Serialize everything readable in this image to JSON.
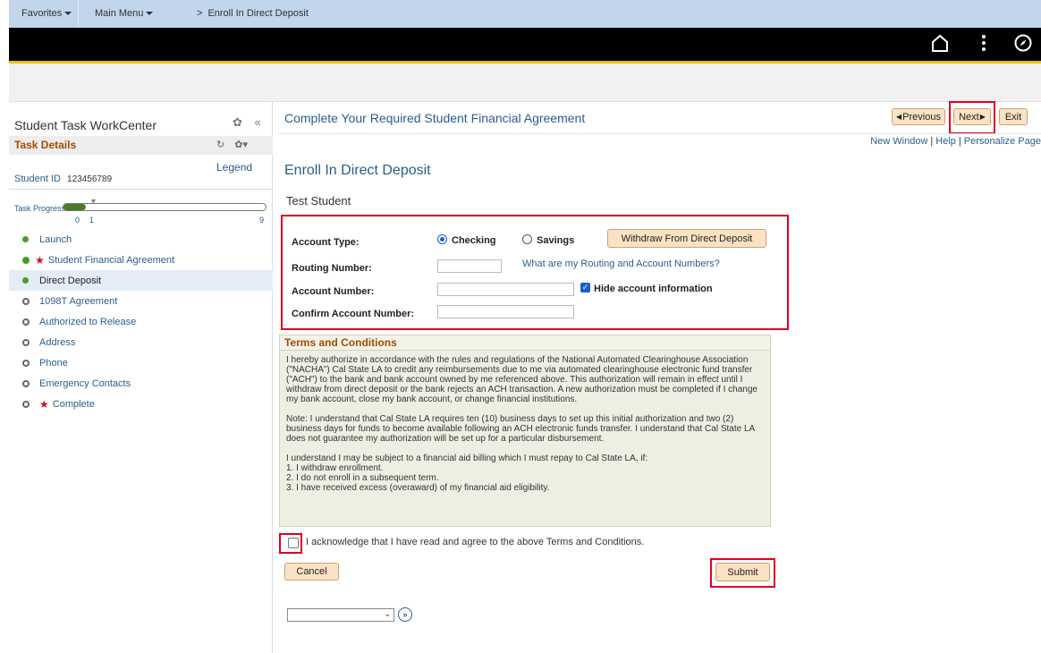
{
  "nav": {
    "favorites": "Favorites",
    "main_menu": "Main Menu",
    "breadcrumb_sep": ">",
    "breadcrumb": "Enroll In Direct Deposit"
  },
  "icons": [
    "home-icon",
    "kebab-menu-icon",
    "compass-icon",
    "settings-icon",
    "collapse-icon",
    "refresh-icon",
    "gear-dropdown-icon",
    "next-circle-icon"
  ],
  "left": {
    "title": "Student Task WorkCenter",
    "collapse": "«",
    "task_details": "Task Details",
    "legend": "Legend",
    "student_id_label": "Student ID",
    "student_id": "123456789",
    "task_progress": "Task Progress",
    "progress_start": "0",
    "progress_current": "1",
    "progress_end": "9",
    "progress_fraction": 0.11,
    "steps": [
      {
        "label": "Launch",
        "status": "done"
      },
      {
        "label": "Student Financial Agreement",
        "status": "complete",
        "required": true
      },
      {
        "label": "Direct Deposit",
        "status": "current"
      },
      {
        "label": "1098T Agreement",
        "status": "todo"
      },
      {
        "label": "Authorized to Release",
        "status": "todo"
      },
      {
        "label": "Address",
        "status": "todo"
      },
      {
        "label": "Phone",
        "status": "todo"
      },
      {
        "label": "Emergency Contacts",
        "status": "todo"
      },
      {
        "label": "Complete",
        "status": "todo",
        "required": true
      }
    ]
  },
  "main": {
    "page_title": "Complete Your Required Student Financial Agreement",
    "previous": "Previous",
    "next": "Next",
    "exit": "Exit",
    "new_window": "New Window",
    "help": "Help",
    "personalize": "Personalize Page",
    "heading": "Enroll In Direct Deposit",
    "student_name": "Test Student"
  },
  "form": {
    "account_type_label": "Account Type:",
    "checking": "Checking",
    "savings": "Savings",
    "selected": "Checking",
    "withdraw_btn": "Withdraw From Direct Deposit",
    "routing_label": "Routing Number:",
    "routing_value": "",
    "help_link": "What are my Routing and Account Numbers?",
    "account_label": "Account Number:",
    "account_value": "",
    "hide_label": "Hide account information",
    "hide_checked": true,
    "confirm_label": "Confirm Account Number:",
    "confirm_value": ""
  },
  "terms": {
    "heading": "Terms and Conditions",
    "para1": "I hereby authorize in accordance with the rules and regulations of the National Automated Clearinghouse Association (\"NACHA\") Cal State LA to credit any reimbursements due to me via automated clearinghouse electronic fund transfer (\"ACH\") to the bank and bank account owned by me referenced above. This authorization will remain in effect until I withdraw from direct deposit or the bank rejects an ACH transaction. A new authorization must be completed if I change my bank account, close my bank account, or change financial institutions.",
    "para2": "Note: I understand that Cal State LA requires ten (10) business days to set up this initial authorization and two (2) business days for funds to become available following an ACH electronic funds transfer.  I understand that Cal State LA does not guarantee my authorization will be set up for a particular disbursement.",
    "para3_intro": "I understand I may be subject to a financial aid billing which I must repay to Cal State LA, if:",
    "items": [
      "1. I withdraw enrollment.",
      "2. I do not enroll in a subsequent term.",
      "3. I have received excess (overaward) of my financial aid eligibility."
    ],
    "ack": "I acknowledge that I have read and agree to the above Terms and Conditions.",
    "ack_checked": false
  },
  "actions": {
    "cancel": "Cancel",
    "submit": "Submit",
    "select_value": "",
    "go": "»"
  },
  "colors": {
    "topnav": "#c2d5ec",
    "accent_yellow": "#f0c000",
    "link_blue": "#2a5d8f",
    "section_orange": "#a64b00",
    "button_bg": "#fbe2c3",
    "highlight_red": "#e00020",
    "progress_green": "#4a7a2a"
  }
}
